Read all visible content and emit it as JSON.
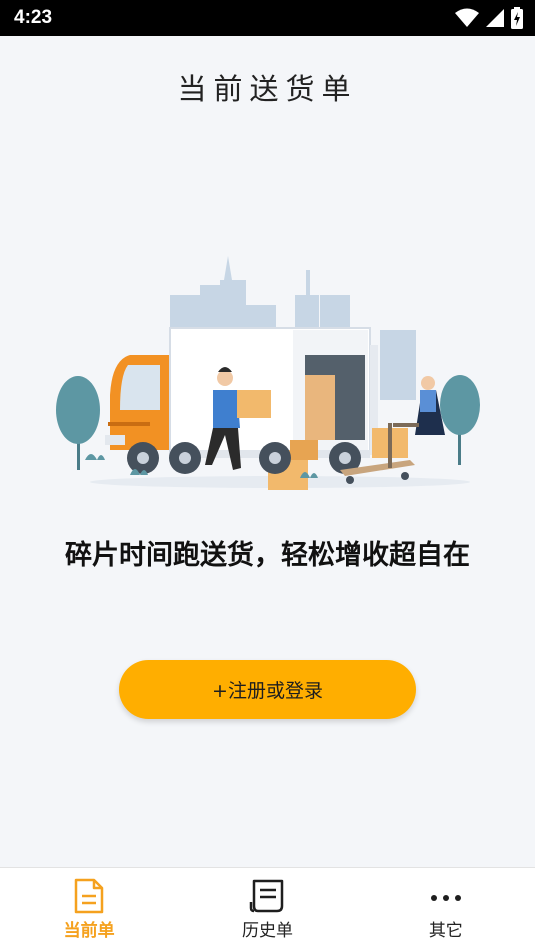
{
  "status_bar": {
    "time": "4:23"
  },
  "header": {
    "title": "当前送货单"
  },
  "hero": {
    "slogan": "碎片时间跑送货，轻松增收超自在"
  },
  "cta": {
    "label": "+注册或登录"
  },
  "tabs": [
    {
      "label": "当前单",
      "icon": "document-icon",
      "active": true
    },
    {
      "label": "历史单",
      "icon": "history-doc-icon",
      "active": false
    },
    {
      "label": "其它",
      "icon": "more-icon",
      "active": false
    }
  ],
  "colors": {
    "accent": "#ffae00",
    "active_tab": "#f5a11e",
    "background": "#f4f6f9"
  }
}
